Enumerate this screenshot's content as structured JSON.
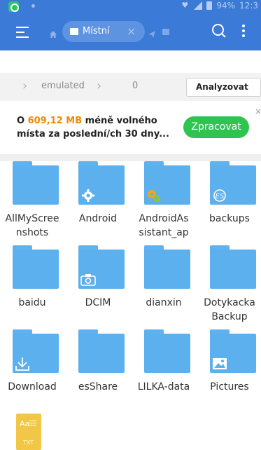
{
  "status_bar": {
    "battery_text": "94%",
    "time": "12:3",
    "icons": [
      "app-badge-icon",
      "heart-icon",
      "signal-icon",
      "battery-icon"
    ]
  },
  "toolbar": {
    "tab_label": "Místní",
    "tab_close": "×",
    "icons": [
      "menu-icon",
      "home-icon",
      "folder-icon",
      "send-icon",
      "search-icon",
      "more-vertical-icon"
    ],
    "accent_color": "#3b7ad6"
  },
  "breadcrumb": {
    "items": [
      "emulated",
      "0"
    ],
    "analyze_label": "Analyzovat"
  },
  "banner": {
    "prefix": "O ",
    "amount": "609,12 MB",
    "suffix": " méně volného místa za poslední/ch 30 dny...",
    "button_label": "Zpracovat",
    "close": "×",
    "highlight_color": "#f08a00",
    "button_color": "#2ec44f"
  },
  "files": [
    {
      "name": "AllMyScreenshots",
      "display": "AllMyScree\nnshots",
      "badge": ""
    },
    {
      "name": "Android",
      "display": "Android",
      "badge": "gear-icon"
    },
    {
      "name": "AndroidAssistant_ap",
      "display": "AndroidAs\nsistant_ap",
      "badge": "app-gear-icon"
    },
    {
      "name": "backups",
      "display": "backups",
      "badge": "es-icon"
    },
    {
      "name": "baidu",
      "display": "baidu",
      "badge": ""
    },
    {
      "name": "DCIM",
      "display": "DCIM",
      "badge": "camera-icon"
    },
    {
      "name": "dianxin",
      "display": "dianxin",
      "badge": ""
    },
    {
      "name": "DotykackaBackup",
      "display": "Dotykacka\nBackup",
      "badge": ""
    },
    {
      "name": "Download",
      "display": "Download",
      "badge": "download-icon"
    },
    {
      "name": "esShare",
      "display": "esShare",
      "badge": ""
    },
    {
      "name": "LILKA-data",
      "display": "LILKA-data",
      "badge": ""
    },
    {
      "name": "Pictures",
      "display": "Pictures",
      "badge": "image-icon"
    }
  ],
  "txt_file": {
    "glyph": "Aa",
    "extension": "TXT"
  },
  "folder_color": "#5cb0ee"
}
